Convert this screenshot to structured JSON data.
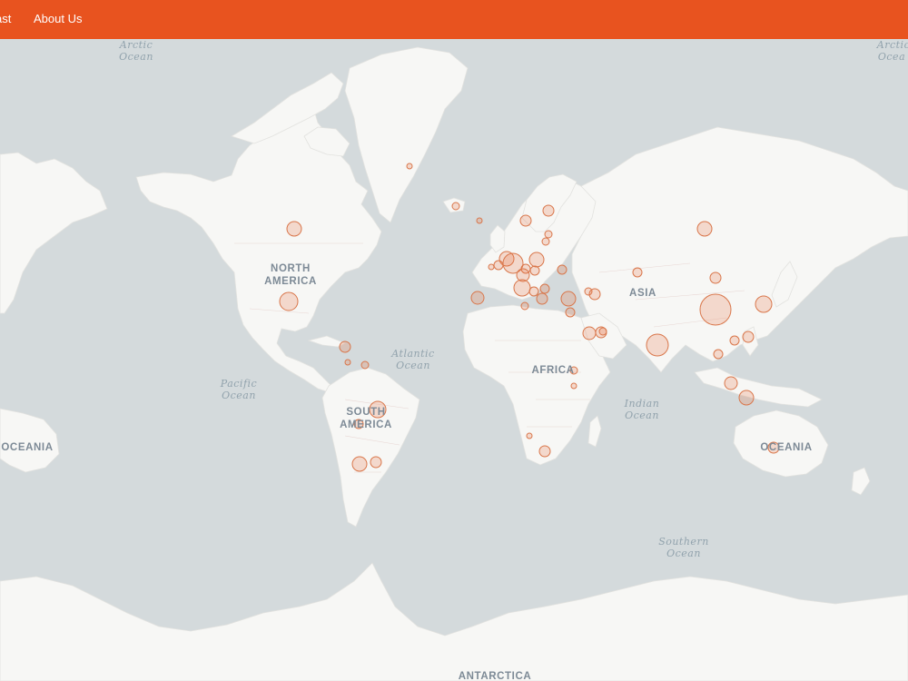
{
  "nav": {
    "items": [
      {
        "label": "ast"
      },
      {
        "label": "About Us"
      }
    ]
  },
  "map": {
    "continent_labels": [
      {
        "line1": "NORTH",
        "line2": "AMERICA"
      },
      {
        "line1": "SOUTH",
        "line2": "AMERICA"
      },
      {
        "line1": "AFRICA",
        "line2": ""
      },
      {
        "line1": "ASIA",
        "line2": ""
      },
      {
        "line1": "OCEANIA",
        "line2": ""
      },
      {
        "line1": "OCEANIA",
        "line2": ""
      },
      {
        "line1": "ANTARCTICA",
        "line2": ""
      }
    ],
    "ocean_labels": [
      {
        "line1": "Arctic",
        "line2": "Ocean"
      },
      {
        "line1": "Arctic",
        "line2": "Ocea"
      },
      {
        "line1": "Pacific",
        "line2": "Ocean"
      },
      {
        "line1": "Atlantic",
        "line2": "Ocean"
      },
      {
        "line1": "Indian",
        "line2": "Ocean"
      },
      {
        "line1": "Southern",
        "line2": "Ocean"
      }
    ],
    "colors": {
      "nav": "#e8531f",
      "ocean": "#d4dadc",
      "land": "#f7f7f5",
      "bubble_fill": "rgba(232,110,60,0.22)",
      "bubble_stroke": "#d9764a"
    }
  }
}
